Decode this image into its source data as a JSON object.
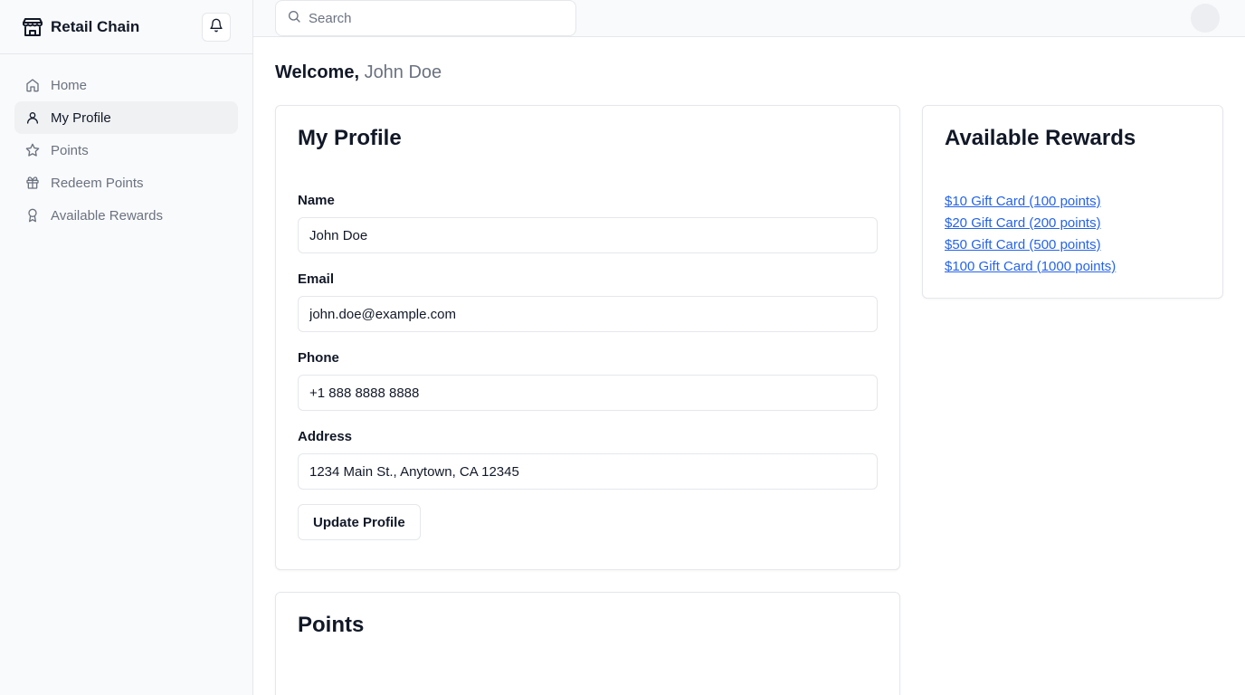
{
  "brand": {
    "name": "Retail Chain",
    "icon": "store-icon"
  },
  "sidebar": {
    "items": [
      {
        "label": "Home",
        "icon": "home-icon",
        "active": false
      },
      {
        "label": "My Profile",
        "icon": "user-icon",
        "active": true
      },
      {
        "label": "Points",
        "icon": "star-icon",
        "active": false
      },
      {
        "label": "Redeem Points",
        "icon": "gift-icon",
        "active": false
      },
      {
        "label": "Available Rewards",
        "icon": "award-icon",
        "active": false
      }
    ]
  },
  "search": {
    "placeholder": "Search",
    "value": ""
  },
  "welcome": {
    "prefix": "Welcome,",
    "user": "John Doe"
  },
  "profile": {
    "title": "My Profile",
    "fields": [
      {
        "label": "Name",
        "value": "John Doe"
      },
      {
        "label": "Email",
        "value": "john.doe@example.com"
      },
      {
        "label": "Phone",
        "value": "+1 888 8888 8888"
      },
      {
        "label": "Address",
        "value": "1234 Main St., Anytown, CA 12345"
      }
    ],
    "submit_label": "Update Profile"
  },
  "points": {
    "title": "Points"
  },
  "rewards": {
    "title": "Available Rewards",
    "items": [
      "$10 Gift Card (100 points)",
      "$20 Gift Card (200 points)",
      "$50 Gift Card (500 points)",
      "$100 Gift Card (1000 points)"
    ]
  },
  "colors": {
    "link": "#2563eb",
    "muted": "#6b7280",
    "active_bg": "#f0f1f3",
    "border": "#e5e7eb"
  }
}
